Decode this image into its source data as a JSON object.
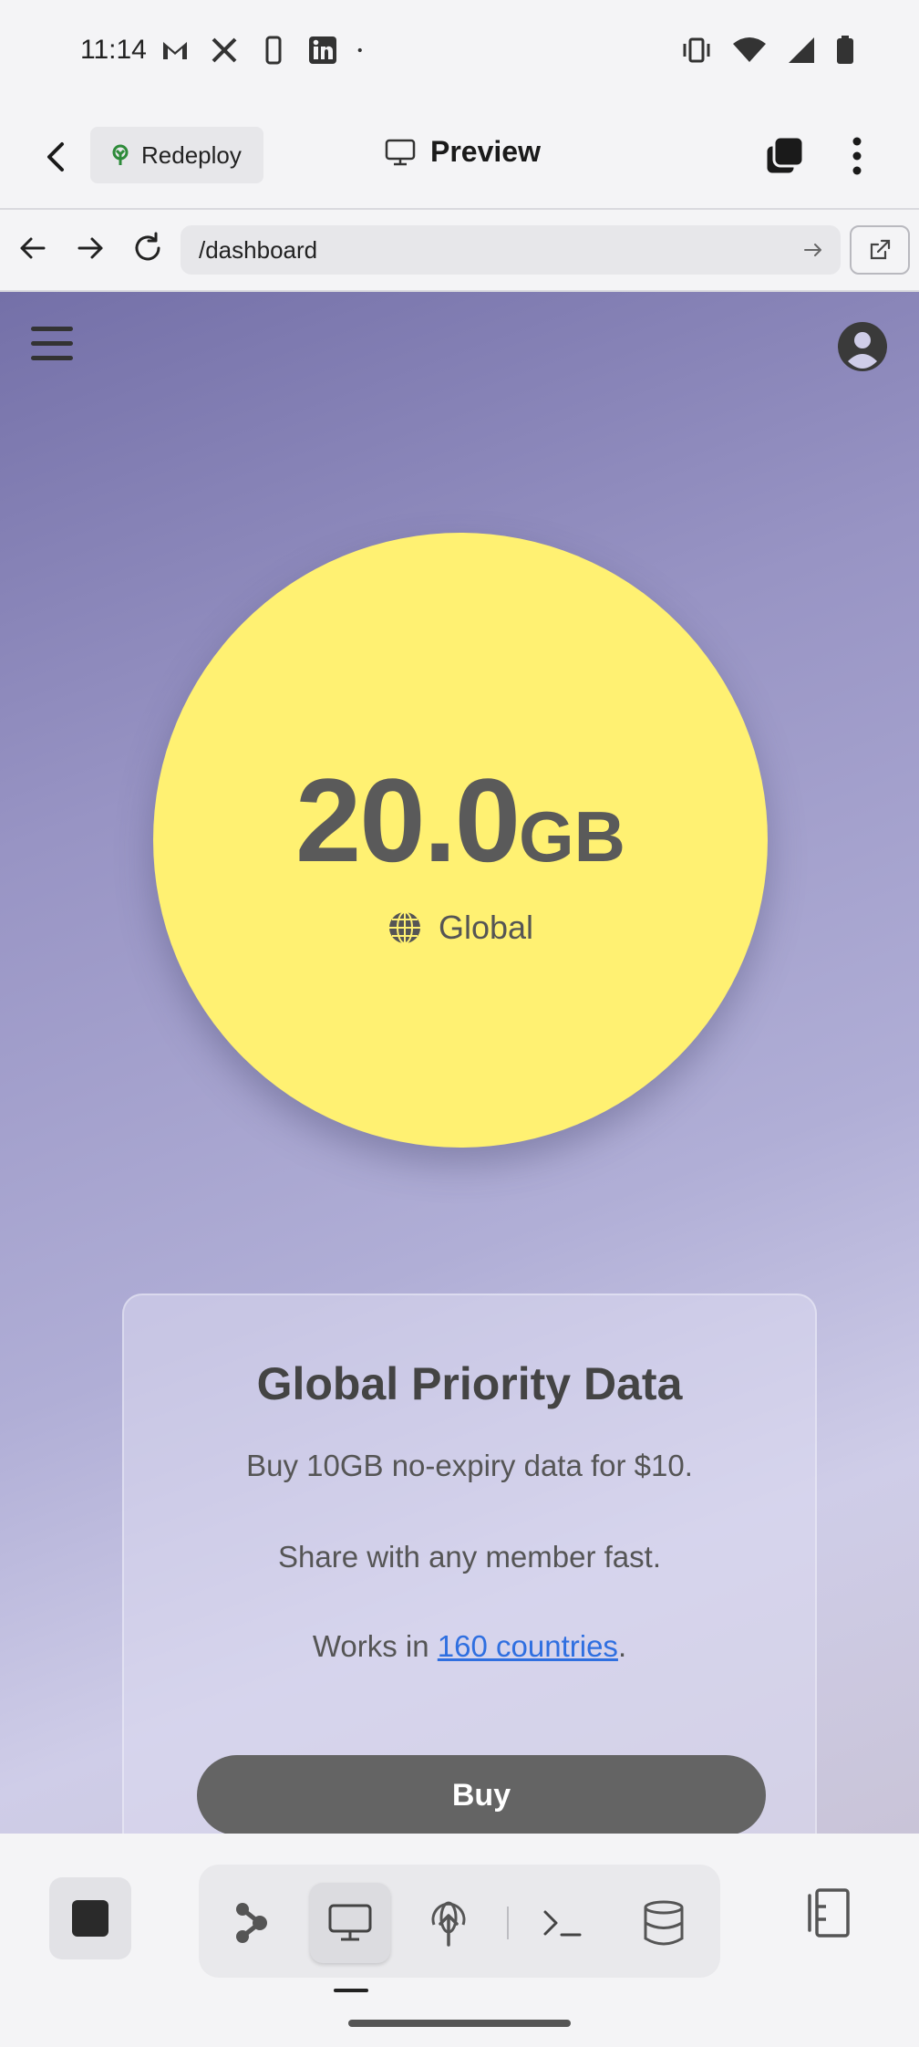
{
  "status_bar": {
    "time": "11:14",
    "notification_icons": [
      "gmail-icon",
      "x-icon",
      "nba-icon",
      "linkedin-icon",
      "dot-icon"
    ],
    "system_icons": [
      "vibrate-icon",
      "wifi-icon",
      "signal-icon",
      "battery-icon"
    ]
  },
  "header": {
    "redeploy_label": "Redeploy",
    "title": "Preview"
  },
  "browser": {
    "url": "/dashboard"
  },
  "dashboard": {
    "data_amount": "20.0",
    "data_unit": "GB",
    "region": "Global",
    "card": {
      "title": "Global Priority Data",
      "line1": "Buy 10GB no-expiry data for $10.",
      "line2": "Share with any member fast.",
      "line3_prefix": "Works in ",
      "line3_link": "160 countries",
      "line3_suffix": ".",
      "buy_label": "Buy"
    }
  },
  "toolbar": {
    "tools": [
      "nodes-icon",
      "preview-icon",
      "deploy-icon",
      "terminal-icon",
      "database-icon"
    ],
    "active_tool": "preview-icon"
  },
  "colors": {
    "circle": "#fff172",
    "buy_button": "#646464",
    "link": "#2f6fe0",
    "background_top": "#7470a8",
    "background_bottom": "#cfcde8"
  }
}
